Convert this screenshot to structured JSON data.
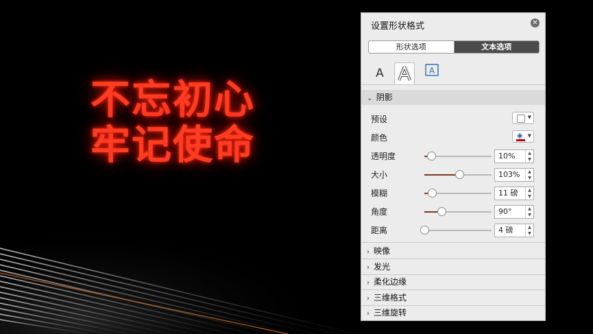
{
  "slide": {
    "headline_line1": "不忘初心",
    "headline_line2": "牢记使命",
    "headline_color": "#ff3b22"
  },
  "panel": {
    "title": "设置形状格式",
    "close_icon": "close-icon",
    "tabs": [
      {
        "label": "形状选项",
        "active": false
      },
      {
        "label": "文本选项",
        "active": true
      }
    ],
    "icon_tabs": [
      {
        "glyph": "A",
        "name": "text-fill-outline-icon",
        "active": false
      },
      {
        "glyph": "A",
        "name": "text-effects-icon",
        "active": true
      },
      {
        "glyph": "A",
        "name": "textbox-icon",
        "active": false
      }
    ],
    "shadow": {
      "label": "阴影",
      "preset_label": "预设",
      "color_label": "颜色",
      "color_value": "#c00000",
      "rows": [
        {
          "label": "透明度",
          "value": "10%",
          "level": 0.1
        },
        {
          "label": "大小",
          "value": "103%",
          "level": 0.52
        },
        {
          "label": "模糊",
          "value": "11 磅",
          "level": 0.11
        },
        {
          "label": "角度",
          "value": "90°",
          "level": 0.25
        },
        {
          "label": "距离",
          "value": "4 磅",
          "level": 0.0
        }
      ]
    },
    "sections": [
      "映像",
      "发光",
      "柔化边缘",
      "三维格式",
      "三维旋转"
    ]
  }
}
